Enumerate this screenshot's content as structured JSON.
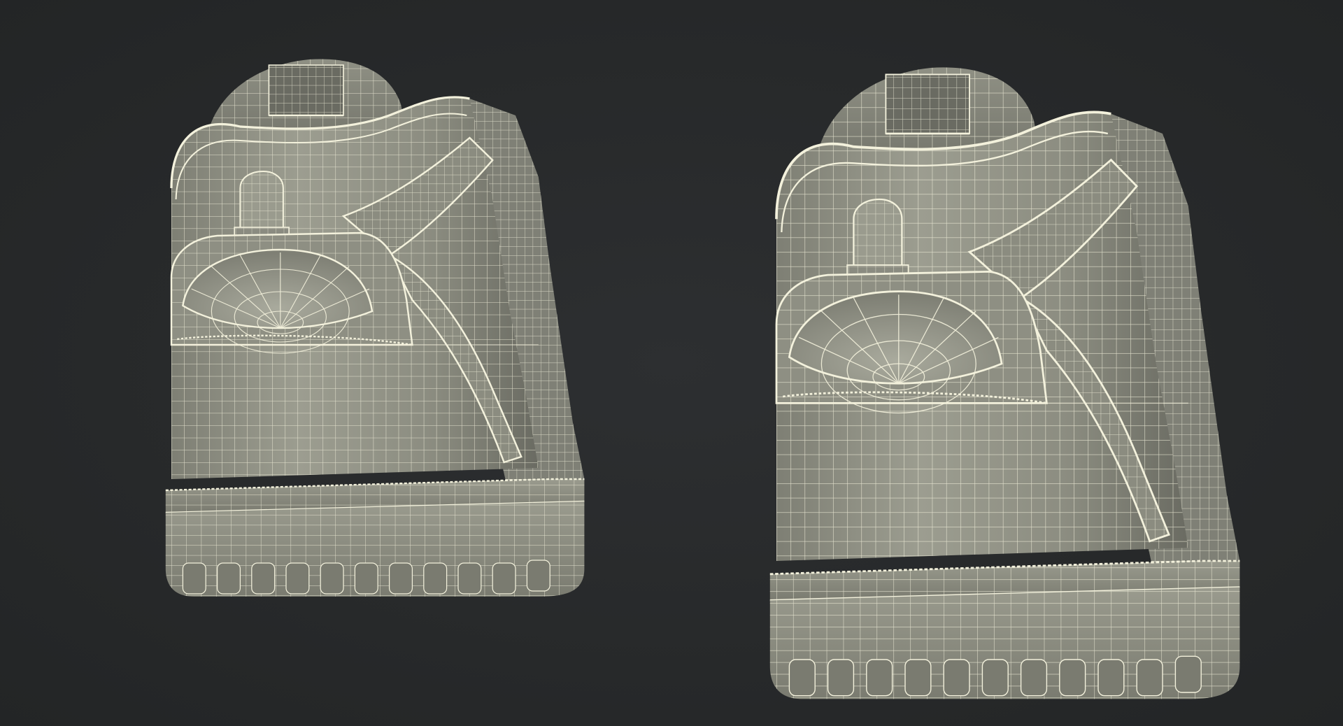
{
  "scene": {
    "subject": "wireframe-render",
    "colors": {
      "background": "#27292b",
      "surface_light": "#a7a89b",
      "surface_mid": "#8d8e82",
      "surface_dark": "#5c5d55",
      "interior": "#6f7068",
      "wire": "#f3f1dc"
    },
    "models": [
      {
        "name": "left-shoe"
      },
      {
        "name": "right-shoe"
      }
    ]
  }
}
